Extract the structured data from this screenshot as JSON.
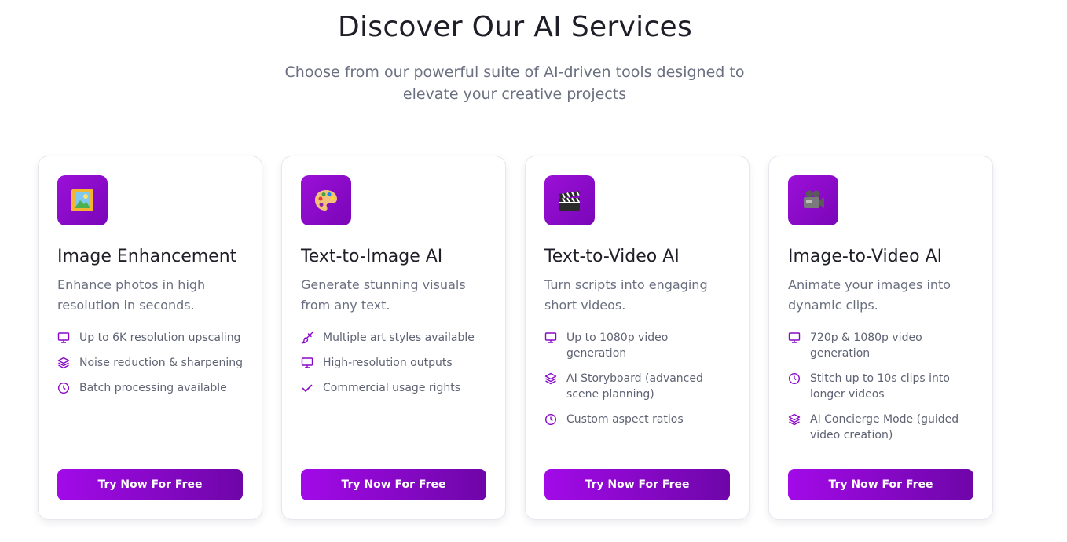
{
  "section": {
    "title": "Discover Our AI Services",
    "subtitle": "Choose from our powerful suite of AI-driven tools designed to elevate your creative projects"
  },
  "colors": {
    "accent": "#8a08c8",
    "accent_dark": "#6e06a8"
  },
  "cards": [
    {
      "icon": "framed-picture-icon",
      "title": "Image Enhancement",
      "description": "Enhance photos in high resolution in seconds.",
      "features": [
        {
          "icon": "monitor-icon",
          "text": "Up to 6K resolution upscaling"
        },
        {
          "icon": "layers-icon",
          "text": "Noise reduction & sharpening"
        },
        {
          "icon": "clock-icon",
          "text": "Batch processing available"
        }
      ],
      "cta": "Try Now For Free"
    },
    {
      "icon": "artist-palette-icon",
      "title": "Text-to-Image AI",
      "description": "Generate stunning visuals from any text.",
      "features": [
        {
          "icon": "paintbrush-icon",
          "text": "Multiple art styles available"
        },
        {
          "icon": "monitor-icon",
          "text": "High-resolution outputs"
        },
        {
          "icon": "check-icon",
          "text": "Commercial usage rights"
        }
      ],
      "cta": "Try Now For Free"
    },
    {
      "icon": "clapper-board-icon",
      "title": "Text-to-Video AI",
      "description": "Turn scripts into engaging short videos.",
      "features": [
        {
          "icon": "monitor-icon",
          "text": "Up to 1080p video generation"
        },
        {
          "icon": "layers-icon",
          "text": "AI Storyboard (advanced scene planning)"
        },
        {
          "icon": "clock-icon",
          "text": "Custom aspect ratios"
        }
      ],
      "cta": "Try Now For Free"
    },
    {
      "icon": "video-camera-icon",
      "title": "Image-to-Video AI",
      "description": "Animate your images into dynamic clips.",
      "features": [
        {
          "icon": "monitor-icon",
          "text": "720p & 1080p video generation"
        },
        {
          "icon": "clock-icon",
          "text": "Stitch up to 10s clips into longer videos"
        },
        {
          "icon": "layers-icon",
          "text": "AI Concierge Mode (guided video creation)"
        }
      ],
      "cta": "Try Now For Free"
    }
  ]
}
